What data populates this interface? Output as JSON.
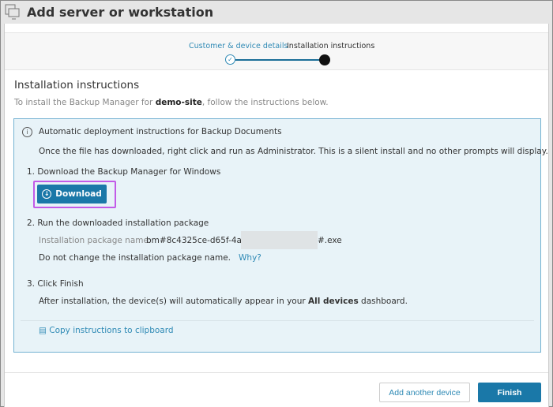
{
  "window": {
    "title": "Add server or workstation"
  },
  "stepper": {
    "steps": [
      {
        "label": "Customer & device details",
        "state": "done"
      },
      {
        "label": "Installation instructions",
        "state": "current"
      }
    ]
  },
  "section": {
    "title": "Installation instructions",
    "intro_pre": "To install the Backup Manager for ",
    "site": "demo-site",
    "intro_post": ", follow the instructions below."
  },
  "info": {
    "heading": "Automatic deployment instructions for Backup Documents",
    "note": "Once the file has downloaded, right click and run as Administrator. This is a silent install and no other prompts will display.",
    "step1": "1. Download the Backup Manager for Windows",
    "download_label": "Download",
    "step2": "2. Run the downloaded installation package",
    "package_label": "Installation package name:",
    "package_prefix": "bm#8c4325ce-d65f-4a9c-",
    "package_suffix": "#.exe",
    "no_change": "Do not change the installation package name.",
    "why": "Why?",
    "step3": "3. Click Finish",
    "after_pre": "After installation, the device(s) will automatically appear in your ",
    "after_bold": "All devices",
    "after_post": " dashboard.",
    "copy": "Copy instructions to clipboard"
  },
  "footer": {
    "add_another": "Add another device",
    "finish": "Finish"
  }
}
